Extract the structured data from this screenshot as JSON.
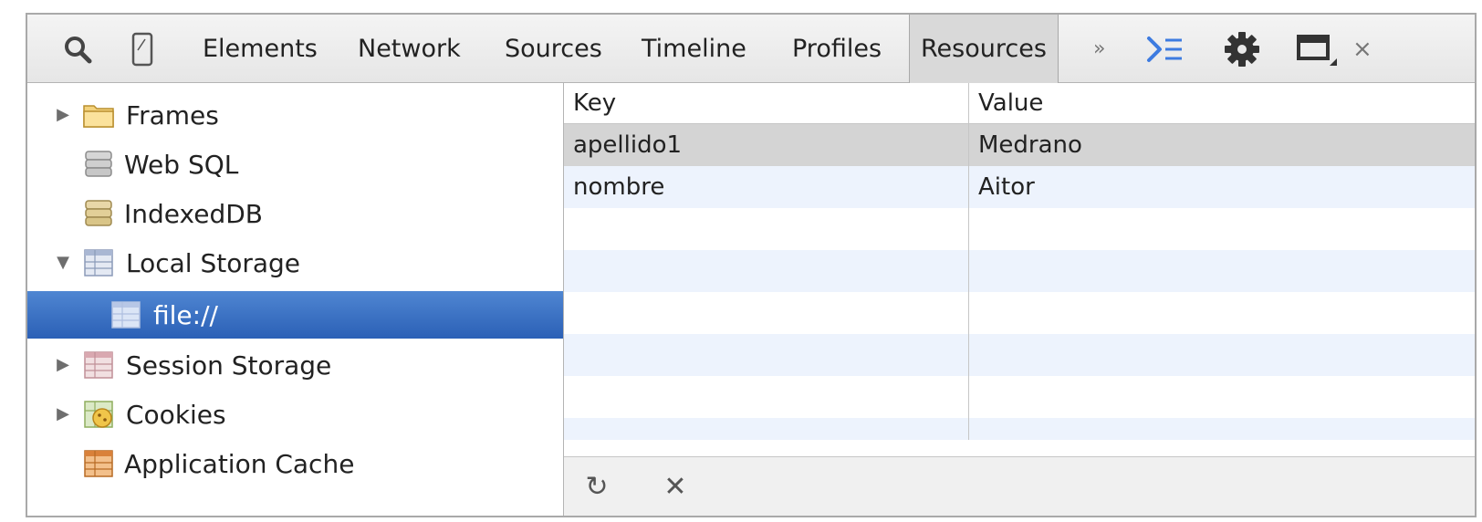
{
  "toolbar": {
    "icons": {
      "search": "search-icon",
      "device": "mobile-device-icon",
      "console": "console-drawer-icon",
      "settings": "gear-icon",
      "dock": "dock-icon",
      "close": "close-icon"
    },
    "tabs": [
      {
        "label": "Elements"
      },
      {
        "label": "Network"
      },
      {
        "label": "Sources"
      },
      {
        "label": "Timeline"
      },
      {
        "label": "Profiles"
      },
      {
        "label": "Resources"
      }
    ],
    "selected_tab": "Resources",
    "overflow_label": "»",
    "close_label": "×",
    "accent_color": "#3d7be0"
  },
  "sidebar": {
    "items": [
      {
        "label": "Frames",
        "icon": "folder-icon"
      },
      {
        "label": "Web SQL",
        "icon": "database-icon"
      },
      {
        "label": "IndexedDB",
        "icon": "database-icon"
      },
      {
        "label": "Local Storage",
        "icon": "storage-grid-icon"
      },
      {
        "label": "file://",
        "icon": "storage-grid-icon"
      },
      {
        "label": "Session Storage",
        "icon": "storage-grid-icon"
      },
      {
        "label": "Cookies",
        "icon": "cookie-icon"
      },
      {
        "label": "Application Cache",
        "icon": "cache-grid-icon"
      }
    ],
    "selected_item": "file://",
    "selection_color": "#2f66bb"
  },
  "table": {
    "columns": [
      "Key",
      "Value"
    ],
    "rows": [
      {
        "key": "apellido1",
        "value": "Medrano"
      },
      {
        "key": "nombre",
        "value": "Aitor"
      }
    ]
  },
  "footer": {
    "refresh_label": "↻",
    "delete_label": "✕"
  }
}
